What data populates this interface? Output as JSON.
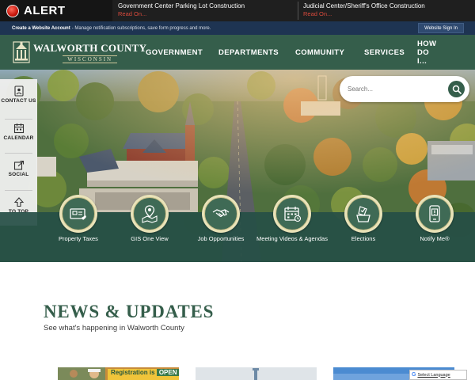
{
  "alert": {
    "label": "ALERT",
    "items": [
      {
        "title": "Government Center Parking Lot Construction",
        "link": "Read On..."
      },
      {
        "title": "Judicial Center/Sheriff's Office Construction",
        "link": "Read On..."
      }
    ]
  },
  "account_bar": {
    "create_label": "Create a Website Account",
    "create_text": " - Manage notification subscriptions, save form progress and more.",
    "signin_label": "Website Sign In"
  },
  "header": {
    "logo_title": "WALWORTH COUNTY",
    "logo_subtitle": "WISCONSIN",
    "nav": [
      "GOVERNMENT",
      "DEPARTMENTS",
      "COMMUNITY",
      "SERVICES",
      "HOW DO I..."
    ]
  },
  "sidebar": [
    {
      "label": "CONTACT US",
      "icon": "contact-card-icon"
    },
    {
      "label": "CALENDAR",
      "icon": "calendar-icon"
    },
    {
      "label": "SOCIAL",
      "icon": "social-share-icon"
    },
    {
      "label": "TO TOP",
      "icon": "arrow-up-icon"
    }
  ],
  "search": {
    "placeholder": "Search..."
  },
  "quicklinks": [
    {
      "label": "Property Taxes",
      "icon": "property-taxes-icon"
    },
    {
      "label": "GIS One View",
      "icon": "map-pin-icon"
    },
    {
      "label": "Job Opportunities",
      "icon": "handshake-icon"
    },
    {
      "label": "Meeting Videos & Agendas",
      "icon": "meeting-calendar-icon"
    },
    {
      "label": "Elections",
      "icon": "ballot-box-icon"
    },
    {
      "label": "Notify Me®",
      "icon": "notify-phone-icon"
    }
  ],
  "news": {
    "title": "NEWS & UPDATES",
    "subtitle": "See what's happening in Walworth County"
  },
  "cards": [
    {
      "banner_text": "Registration is",
      "banner_highlight": "OPEN"
    }
  ],
  "translate": {
    "brand": "G",
    "label": "Select Language"
  },
  "colors": {
    "brand_green": "#355e4b",
    "alert_bar": "#1f1f1f",
    "account_bar": "#1e3452",
    "accent_cream": "#e9e3b9",
    "read_on": "#d94a3c"
  }
}
